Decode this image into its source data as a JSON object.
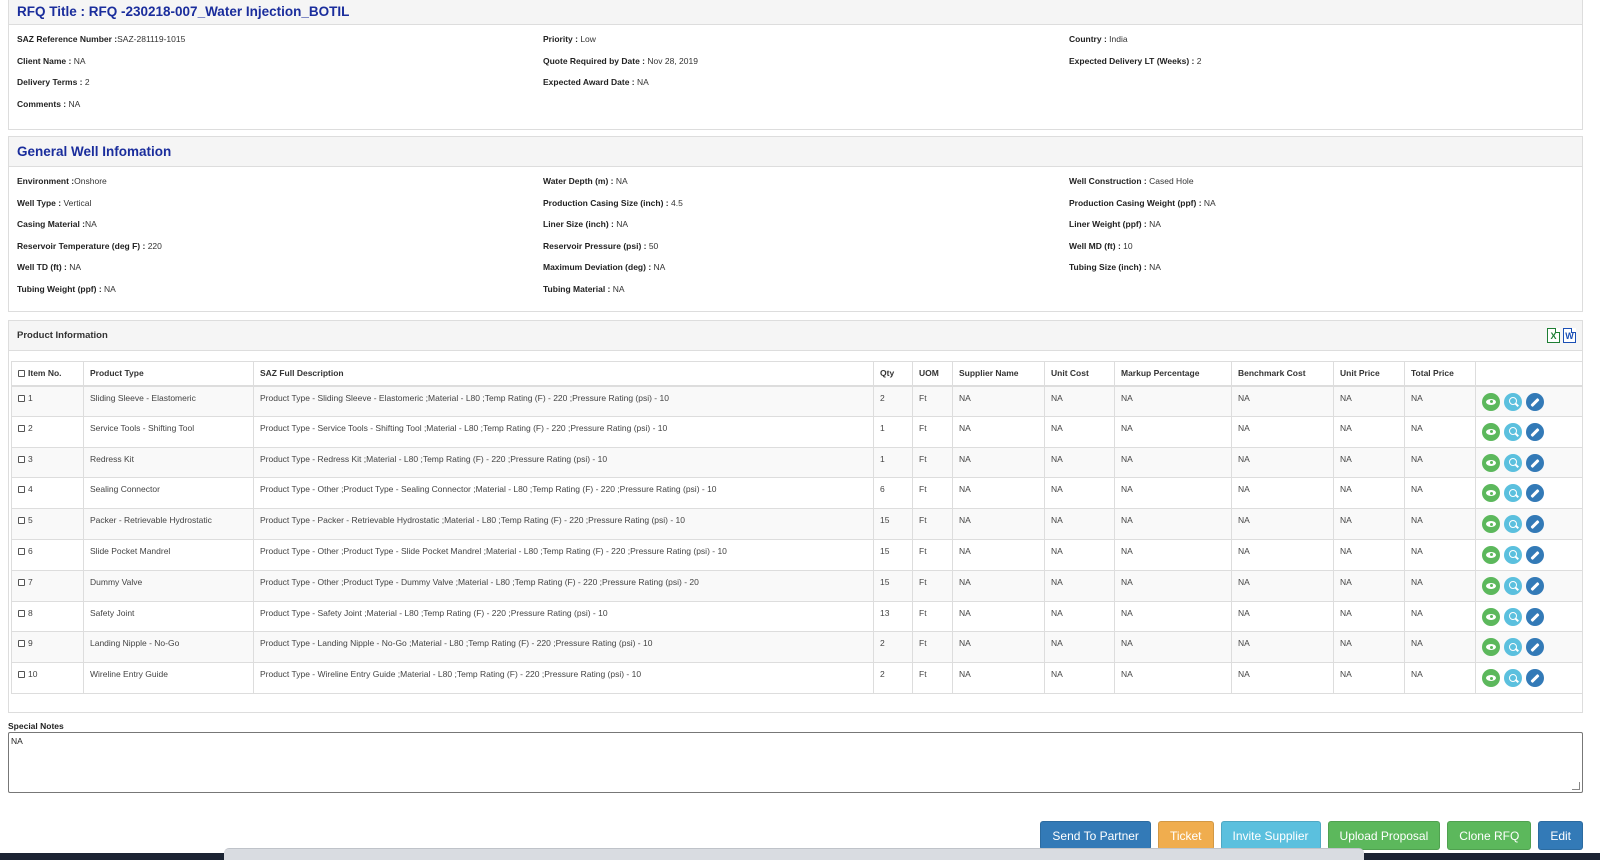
{
  "rfq": {
    "title": "RFQ Title : RFQ -230218-007_Water Injection_BOTIL",
    "fields": [
      {
        "label": "SAZ Reference Number :",
        "value": "SAZ-281119-1015"
      },
      {
        "label": "Priority :",
        "value": " Low"
      },
      {
        "label": "Country :",
        "value": " India"
      },
      {
        "label": "Client Name :",
        "value": " NA"
      },
      {
        "label": "Quote Required by Date :",
        "value": " Nov 28, 2019"
      },
      {
        "label": "Expected Delivery LT (Weeks) :",
        "value": " 2"
      },
      {
        "label": "Delivery Terms :",
        "value": " 2"
      },
      {
        "label": "Expected Award Date :",
        "value": " NA"
      },
      {
        "label": "",
        "value": ""
      },
      {
        "label": "Comments :",
        "value": " NA"
      }
    ]
  },
  "well": {
    "title": "General Well Infomation",
    "fields": [
      {
        "label": "Environment :",
        "value": "Onshore"
      },
      {
        "label": "Water Depth (m) :",
        "value": " NA"
      },
      {
        "label": "Well Construction :",
        "value": " Cased Hole"
      },
      {
        "label": "Well Type :",
        "value": " Vertical"
      },
      {
        "label": "Production Casing Size (inch) :",
        "value": " 4.5"
      },
      {
        "label": "Production Casing Weight (ppf) :",
        "value": " NA"
      },
      {
        "label": "Casing Material :",
        "value": "NA"
      },
      {
        "label": "Liner Size (inch) :",
        "value": " NA"
      },
      {
        "label": "Liner Weight (ppf) :",
        "value": " NA"
      },
      {
        "label": "Reservoir Temperature (deg F) :",
        "value": " 220"
      },
      {
        "label": "Reservoir Pressure (psi) :",
        "value": " 50"
      },
      {
        "label": "Well MD (ft) :",
        "value": " 10"
      },
      {
        "label": "Well TD (ft) :",
        "value": " NA"
      },
      {
        "label": "Maximum Deviation (deg) :",
        "value": " NA"
      },
      {
        "label": "Tubing Size (inch) :",
        "value": " NA"
      },
      {
        "label": "Tubing Weight (ppf) :",
        "value": " NA"
      },
      {
        "label": "Tubing Material :",
        "value": " NA"
      }
    ]
  },
  "products": {
    "title": "Product Information",
    "export_icons": {
      "excel": "X",
      "word": "W"
    },
    "columns": [
      "Item No.",
      "Product Type",
      "SAZ Full Description",
      "Qty",
      "UOM",
      "Supplier Name",
      "Unit Cost",
      "Markup Percentage",
      "Benchmark Cost",
      "Unit Price",
      "Total Price",
      ""
    ],
    "rows": [
      {
        "item": "1",
        "type": "Sliding Sleeve - Elastomeric",
        "desc": "Product Type - Sliding Sleeve - Elastomeric ;Material - L80 ;Temp Rating (F) - 220 ;Pressure Rating (psi) - 10",
        "qty": "2",
        "uom": "Ft",
        "supplier": "NA",
        "unit_cost": "NA",
        "markup": "NA",
        "benchmark": "NA",
        "unit_price": "NA",
        "total": "NA"
      },
      {
        "item": "2",
        "type": "Service Tools - Shifting Tool",
        "desc": "Product Type - Service Tools - Shifting Tool ;Material - L80 ;Temp Rating (F) - 220 ;Pressure Rating (psi) - 10",
        "qty": "1",
        "uom": "Ft",
        "supplier": "NA",
        "unit_cost": "NA",
        "markup": "NA",
        "benchmark": "NA",
        "unit_price": "NA",
        "total": "NA"
      },
      {
        "item": "3",
        "type": "Redress Kit",
        "desc": "Product Type - Redress Kit ;Material - L80 ;Temp Rating (F) - 220 ;Pressure Rating (psi) - 10",
        "qty": "1",
        "uom": "Ft",
        "supplier": "NA",
        "unit_cost": "NA",
        "markup": "NA",
        "benchmark": "NA",
        "unit_price": "NA",
        "total": "NA"
      },
      {
        "item": "4",
        "type": "Sealing Connector",
        "desc": "Product Type - Other ;Product Type - Sealing Connector ;Material - L80 ;Temp Rating (F) - 220 ;Pressure Rating (psi) - 10",
        "qty": "6",
        "uom": "Ft",
        "supplier": "NA",
        "unit_cost": "NA",
        "markup": "NA",
        "benchmark": "NA",
        "unit_price": "NA",
        "total": "NA"
      },
      {
        "item": "5",
        "type": "Packer - Retrievable Hydrostatic",
        "desc": "Product Type - Packer - Retrievable Hydrostatic ;Material - L80 ;Temp Rating (F) - 220 ;Pressure Rating (psi) - 10",
        "qty": "15",
        "uom": "Ft",
        "supplier": "NA",
        "unit_cost": "NA",
        "markup": "NA",
        "benchmark": "NA",
        "unit_price": "NA",
        "total": "NA"
      },
      {
        "item": "6",
        "type": "Slide Pocket Mandrel",
        "desc": "Product Type - Other ;Product Type - Slide Pocket Mandrel ;Material - L80 ;Temp Rating (F) - 220 ;Pressure Rating (psi) - 10",
        "qty": "15",
        "uom": "Ft",
        "supplier": "NA",
        "unit_cost": "NA",
        "markup": "NA",
        "benchmark": "NA",
        "unit_price": "NA",
        "total": "NA"
      },
      {
        "item": "7",
        "type": "Dummy Valve",
        "desc": "Product Type - Other ;Product Type - Dummy Valve ;Material - L80 ;Temp Rating (F) - 220 ;Pressure Rating (psi) - 20",
        "qty": "15",
        "uom": "Ft",
        "supplier": "NA",
        "unit_cost": "NA",
        "markup": "NA",
        "benchmark": "NA",
        "unit_price": "NA",
        "total": "NA"
      },
      {
        "item": "8",
        "type": "Safety Joint",
        "desc": "Product Type - Safety Joint ;Material - L80 ;Temp Rating (F) - 220 ;Pressure Rating (psi) - 10",
        "qty": "13",
        "uom": "Ft",
        "supplier": "NA",
        "unit_cost": "NA",
        "markup": "NA",
        "benchmark": "NA",
        "unit_price": "NA",
        "total": "NA"
      },
      {
        "item": "9",
        "type": "Landing Nipple - No-Go",
        "desc": "Product Type - Landing Nipple - No-Go ;Material - L80 ;Temp Rating (F) - 220 ;Pressure Rating (psi) - 10",
        "qty": "2",
        "uom": "Ft",
        "supplier": "NA",
        "unit_cost": "NA",
        "markup": "NA",
        "benchmark": "NA",
        "unit_price": "NA",
        "total": "NA"
      },
      {
        "item": "10",
        "type": "Wireline Entry Guide",
        "desc": "Product Type - Wireline Entry Guide ;Material - L80 ;Temp Rating (F) - 220 ;Pressure Rating (psi) - 10",
        "qty": "2",
        "uom": "Ft",
        "supplier": "NA",
        "unit_cost": "NA",
        "markup": "NA",
        "benchmark": "NA",
        "unit_price": "NA",
        "total": "NA"
      }
    ],
    "row_actions": [
      "eye-icon",
      "search-icon",
      "pencil-icon"
    ]
  },
  "notes": {
    "label": "Special Notes",
    "value": "NA"
  },
  "buttons": {
    "send_to_partner": "Send To Partner",
    "ticket": "Ticket",
    "invite_supplier": "Invite Supplier",
    "upload_proposal": "Upload Proposal",
    "clone_rfq": "Clone RFQ",
    "edit": "Edit"
  },
  "colors": {
    "title_blue": "#1a2d9c",
    "primary": "#337ab7",
    "warning": "#f0ad4e",
    "info": "#5bc0de",
    "success": "#5cb85c"
  }
}
